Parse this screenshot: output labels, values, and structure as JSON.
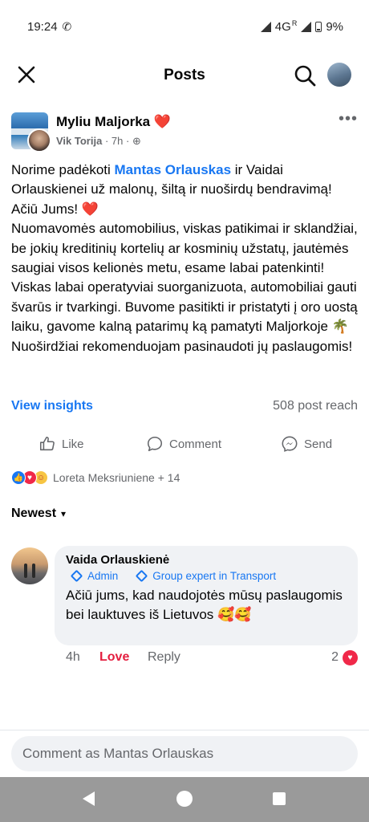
{
  "status_bar": {
    "time": "19:24",
    "network": "4G",
    "roaming": "R",
    "battery": "9%"
  },
  "top_bar": {
    "title": "Posts"
  },
  "post": {
    "group_name": "Myliu Maljorka",
    "group_heart": "❤️",
    "author": "Vik Torija",
    "time": "7h",
    "privacy_icon": "globe-icon",
    "text_before": "Norime padėkoti ",
    "mention": "Mantas Orlauskas",
    "text_after": " ir Vaidai Orlauskienei už malonų, šiltą ir nuoširdų bendravimą! Ačiū Jums! ❤️\nNuomavomės automobilius, viskas patikimai ir sklandžiai, be jokių kreditinių kortelių ar kosminių užstatų, jautėmės saugiai visos kelionės metu, esame labai patenkinti! Viskas labai operatyviai suorganizuota, automobiliai gauti švarūs ir tvarkingi. Buvome pasitikti ir pristatyti į oro uostą laiku, gavome kalną patarimų ką pamatyti Maljorkoje 🌴\nNuoširdžiai rekomenduojam pasinaudoti jų paslaugomis!",
    "insights_link": "View insights",
    "reach": "508 post reach",
    "actions": {
      "like": "Like",
      "comment": "Comment",
      "send": "Send"
    },
    "reactions_text": "Loreta Meksriuniene + 14"
  },
  "comments": {
    "sort_label": "Newest",
    "items": [
      {
        "author": "Vaida Orlauskienė",
        "badge_admin": "Admin",
        "badge_expert": "Group expert in Transport",
        "text": "Ačiū jums, kad naudojotės mūsų paslaugomis bei lauktuves iš Lietuvos 🥰🥰",
        "time": "4h",
        "love_label": "Love",
        "reply_label": "Reply",
        "reaction_count": "2"
      }
    ]
  },
  "composer": {
    "placeholder": "Comment as Mantas Orlauskas"
  },
  "colors": {
    "accent": "#1877f2",
    "love": "#e41e3f",
    "secondary_text": "#65676b",
    "bubble_bg": "#f0f2f5"
  }
}
